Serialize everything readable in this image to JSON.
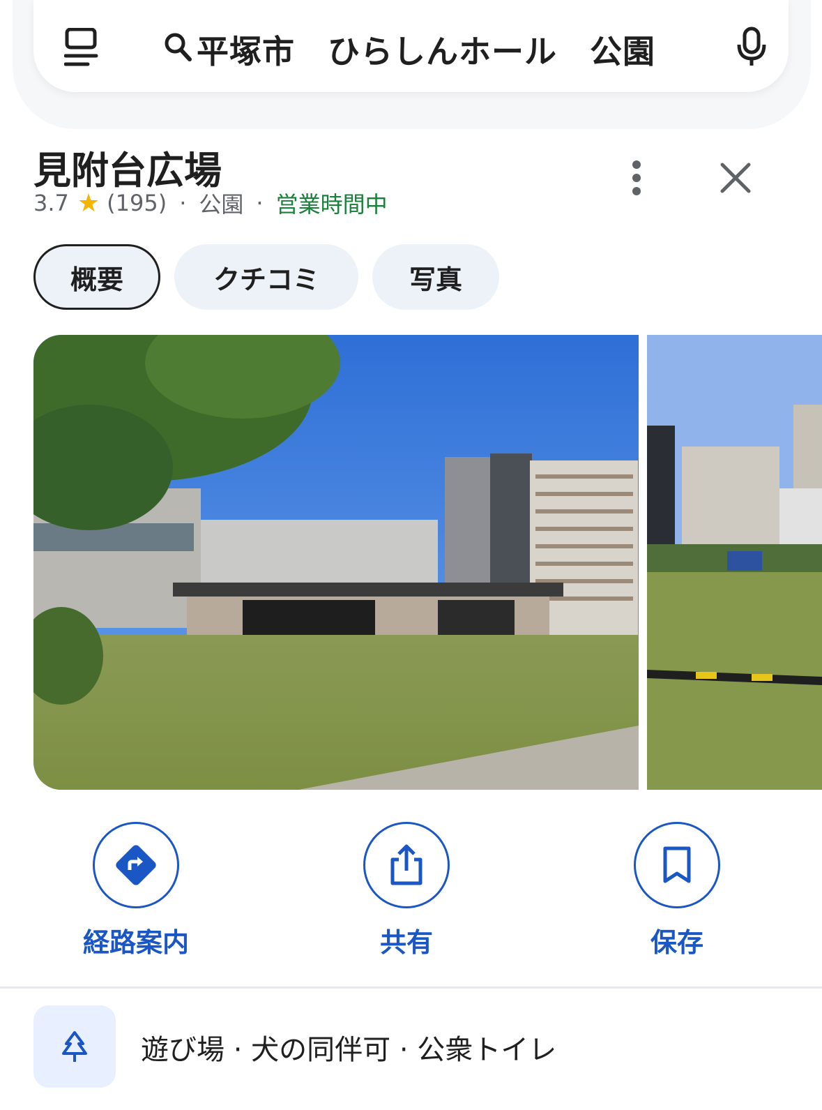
{
  "search": {
    "query": "平塚市　ひらしんホール　公園"
  },
  "place": {
    "title": "見附台広場",
    "rating": "3.7",
    "review_count": "(195)",
    "category": "公園",
    "open_status": "営業時間中",
    "separator": "·"
  },
  "tabs": [
    {
      "label": "概要",
      "active": true
    },
    {
      "label": "クチコミ",
      "active": false
    },
    {
      "label": "写真",
      "active": false
    }
  ],
  "actions": {
    "directions": "経路案内",
    "share": "共有",
    "save": "保存"
  },
  "amenities": {
    "text": "遊び場 · 犬の同伴可 · 公衆トイレ"
  },
  "icons": {
    "menu": "menu-icon",
    "search": "search-icon",
    "mic": "mic-icon",
    "star": "star-icon",
    "more": "more-vert-icon",
    "close": "close-icon",
    "directions": "directions-icon",
    "share": "share-icon",
    "save": "bookmark-icon",
    "amenity": "tree-icon"
  },
  "colors": {
    "accent": "#1a56c4",
    "open": "#188038",
    "star": "#f5b400"
  }
}
